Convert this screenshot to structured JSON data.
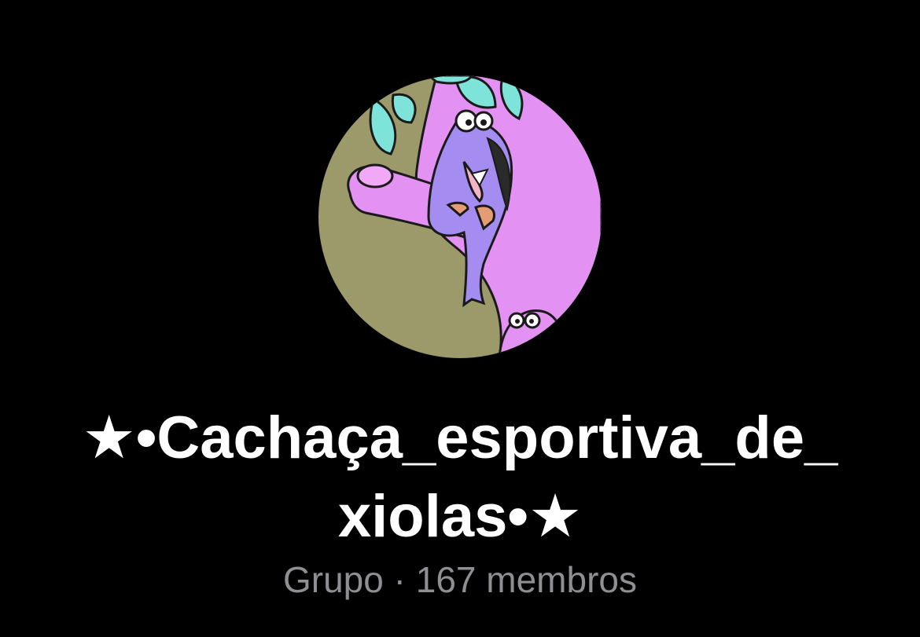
{
  "group": {
    "avatar_icon": "group-avatar-bird-on-branch",
    "title_line1": "★•Cachaça_esportiva_de_",
    "title_line2": "xiolas•★",
    "type_label": "Grupo",
    "separator": "·",
    "members_count": "167",
    "members_label": "membros"
  },
  "colors": {
    "background": "#000000",
    "title": "#ffffff",
    "subtitle": "#8e8e93",
    "avatar_olive": "#9c9a6a",
    "avatar_pink": "#e391f2",
    "avatar_leaf": "#7ee3d8",
    "avatar_bird": "#a58cf0"
  }
}
